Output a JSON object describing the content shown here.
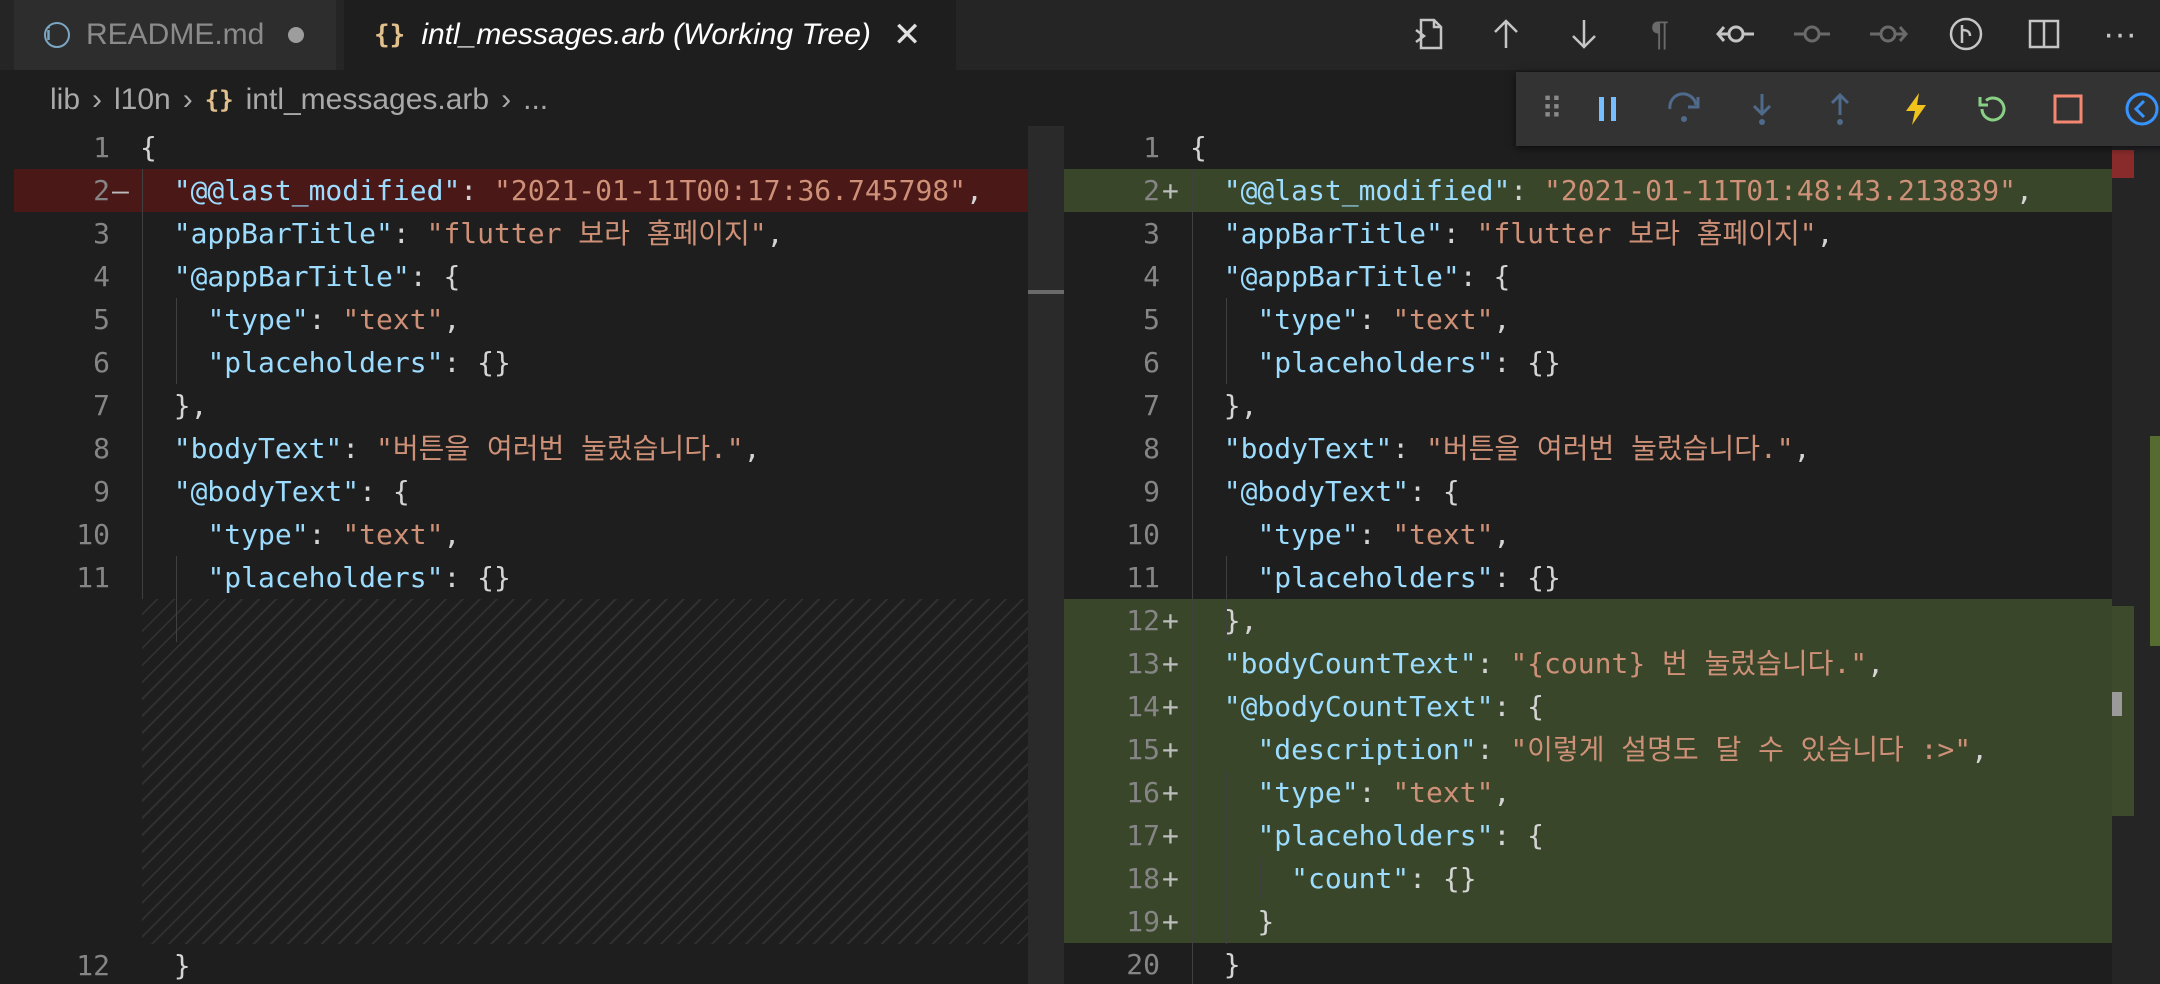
{
  "tabs": [
    {
      "label": "README.md",
      "icon": "info-icon",
      "dirty": true
    },
    {
      "label": "intl_messages.arb (Working Tree)",
      "icon": "braces-icon",
      "active": true
    }
  ],
  "breadcrumb": [
    "lib",
    "l10n",
    "intl_messages.arb",
    "..."
  ],
  "toolbar_icons": [
    "open-file-icon",
    "arrow-up-icon",
    "arrow-down-icon",
    "pilcrow-icon",
    "git-compare-icon",
    "git-commit-icon",
    "git-next-icon",
    "git-graph-icon",
    "split-editor-icon",
    "more-icon"
  ],
  "debug_toolbar": [
    "drag-handle-icon",
    "pause-icon",
    "step-over-icon",
    "step-into-icon",
    "step-out-icon",
    "hot-reload-icon",
    "restart-icon",
    "stop-icon",
    "devtools-icon"
  ],
  "colors": {
    "removed": "#4b1818",
    "added": "#39462a",
    "key": "#9cdcfe",
    "string": "#ce9178"
  },
  "left_lines": [
    {
      "n": "1",
      "t": "{"
    },
    {
      "n": "2",
      "m": "—",
      "t": "  \"@@last_modified\": \"2021-01-11T00:17:36.745798\",",
      "state": "removed"
    },
    {
      "n": "3",
      "t": "  \"appBarTitle\": \"flutter 보라 홈페이지\","
    },
    {
      "n": "4",
      "t": "  \"@appBarTitle\": {"
    },
    {
      "n": "5",
      "t": "    \"type\": \"text\","
    },
    {
      "n": "6",
      "t": "    \"placeholders\": {}"
    },
    {
      "n": "7",
      "t": "  },"
    },
    {
      "n": "8",
      "t": "  \"bodyText\": \"버튼을 여러번 눌렀습니다.\","
    },
    {
      "n": "9",
      "t": "  \"@bodyText\": {"
    },
    {
      "n": "10",
      "t": "    \"type\": \"text\","
    },
    {
      "n": "11",
      "t": "    \"placeholders\": {}"
    },
    {
      "n": "12",
      "t": "  }"
    }
  ],
  "right_lines": [
    {
      "n": "1",
      "t": "{"
    },
    {
      "n": "2",
      "m": "+",
      "t": "  \"@@last_modified\": \"2021-01-11T01:48:43.213839\",",
      "state": "added"
    },
    {
      "n": "3",
      "t": "  \"appBarTitle\": \"flutter 보라 홈페이지\","
    },
    {
      "n": "4",
      "t": "  \"@appBarTitle\": {"
    },
    {
      "n": "5",
      "t": "    \"type\": \"text\","
    },
    {
      "n": "6",
      "t": "    \"placeholders\": {}"
    },
    {
      "n": "7",
      "t": "  },"
    },
    {
      "n": "8",
      "t": "  \"bodyText\": \"버튼을 여러번 눌렀습니다.\","
    },
    {
      "n": "9",
      "t": "  \"@bodyText\": {"
    },
    {
      "n": "10",
      "t": "    \"type\": \"text\","
    },
    {
      "n": "11",
      "t": "    \"placeholders\": {}"
    },
    {
      "n": "12",
      "m": "+",
      "t": "  },",
      "state": "added"
    },
    {
      "n": "13",
      "m": "+",
      "t": "  \"bodyCountText\": \"{count} 번 눌렀습니다.\",",
      "state": "added"
    },
    {
      "n": "14",
      "m": "+",
      "t": "  \"@bodyCountText\": {",
      "state": "added"
    },
    {
      "n": "15",
      "m": "+",
      "t": "    \"description\": \"이렇게 설명도 달 수 있습니다 :>\",",
      "state": "added"
    },
    {
      "n": "16",
      "m": "+",
      "t": "    \"type\": \"text\",",
      "state": "added"
    },
    {
      "n": "17",
      "m": "+",
      "t": "    \"placeholders\": {",
      "state": "added"
    },
    {
      "n": "18",
      "m": "+",
      "t": "      \"count\": {}",
      "state": "added"
    },
    {
      "n": "19",
      "m": "+",
      "t": "    }",
      "state": "added"
    },
    {
      "n": "20",
      "t": "  }"
    }
  ]
}
